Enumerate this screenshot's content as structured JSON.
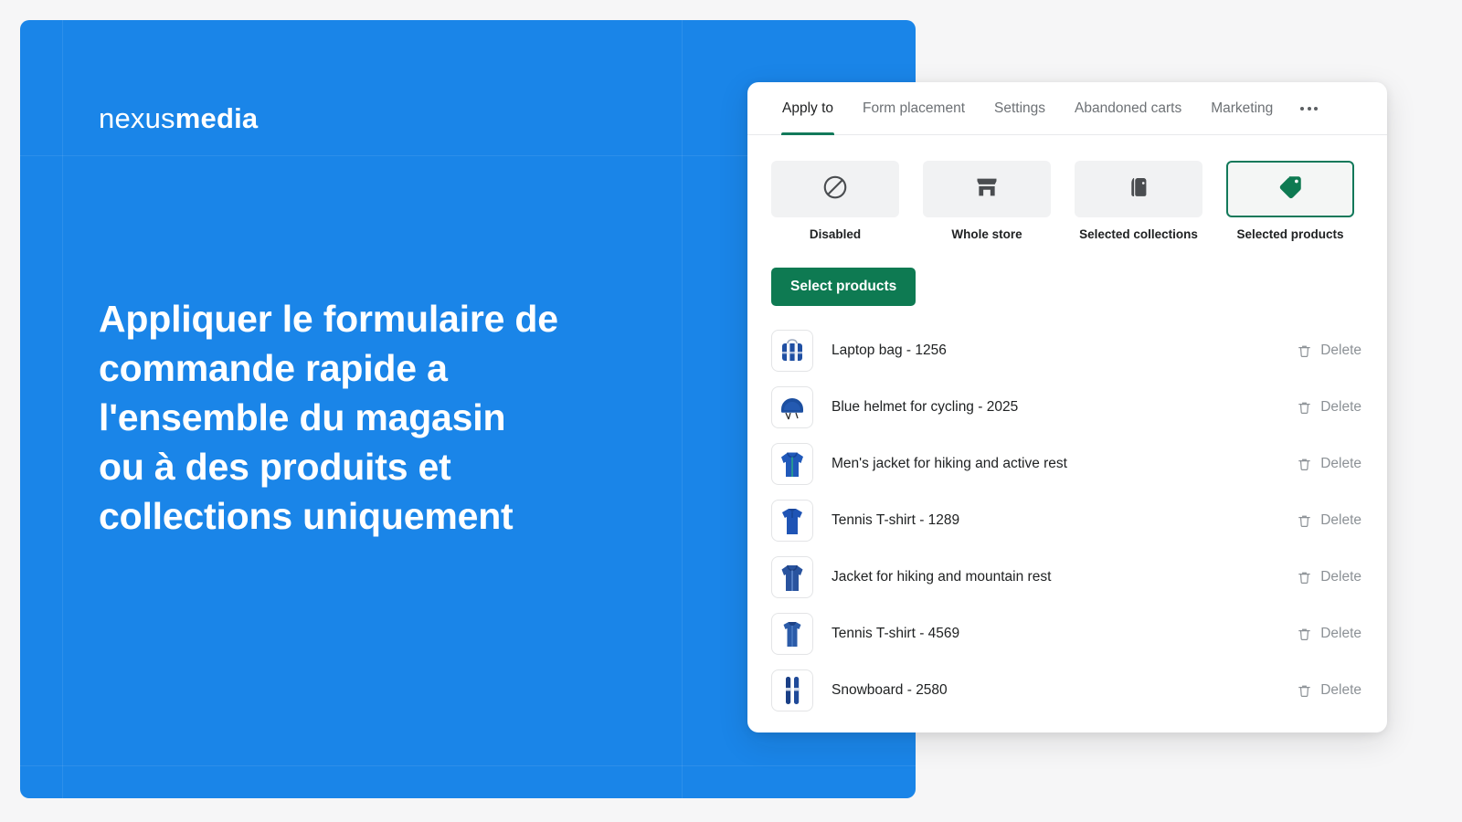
{
  "promo": {
    "logo": {
      "thin": "nexus",
      "bold": "media"
    },
    "headline_lines": [
      "Appliquer le formulaire de",
      "commande rapide a",
      "l'ensemble du magasin",
      "ou à des produits et",
      "collections uniquement"
    ],
    "background_color": "#1a85e8"
  },
  "panel": {
    "tabs": [
      {
        "label": "Apply to",
        "active": true
      },
      {
        "label": "Form placement",
        "active": false
      },
      {
        "label": "Settings",
        "active": false
      },
      {
        "label": "Abandoned carts",
        "active": false
      },
      {
        "label": "Marketing",
        "active": false
      }
    ],
    "more_menu": {
      "name": "overflow-menu",
      "glyph": "..."
    },
    "accent_color": "#12795a",
    "options": [
      {
        "label": "Disabled",
        "icon": "prohibition-icon",
        "selected": false
      },
      {
        "label": "Whole store",
        "icon": "store-icon",
        "selected": false
      },
      {
        "label": "Selected collections",
        "icon": "collection-tag-icon",
        "selected": false
      },
      {
        "label": "Selected products",
        "icon": "price-tag-icon",
        "selected": true
      }
    ],
    "select_products_button": "Select products",
    "delete_label": "Delete",
    "products": [
      {
        "name": "Laptop bag - 1256",
        "thumb": "laptop-bag"
      },
      {
        "name": "Blue helmet for cycling - 2025",
        "thumb": "helmet"
      },
      {
        "name": "Men's jacket for hiking and active rest",
        "thumb": "hoodie"
      },
      {
        "name": "Tennis T-shirt - 1289",
        "thumb": "polo"
      },
      {
        "name": "Jacket for hiking and mountain rest",
        "thumb": "jacket"
      },
      {
        "name": "Tennis T-shirt - 4569",
        "thumb": "tank"
      },
      {
        "name": "Snowboard - 2580",
        "thumb": "skis"
      }
    ]
  }
}
